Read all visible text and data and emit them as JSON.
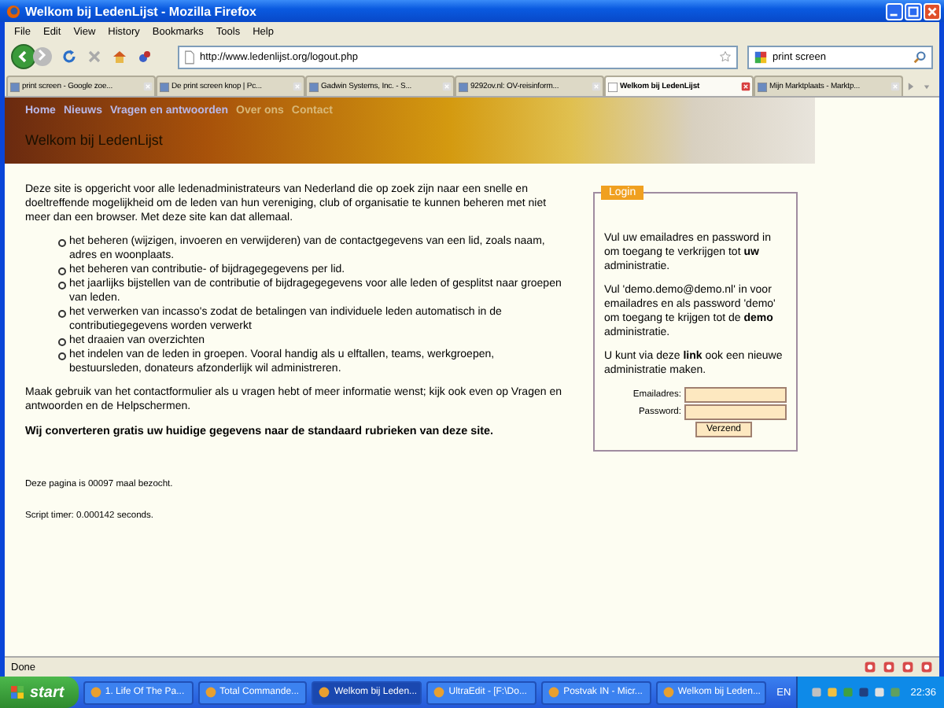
{
  "window": {
    "title": "Welkom bij LedenLijst - Mozilla Firefox"
  },
  "menu": [
    "File",
    "Edit",
    "View",
    "History",
    "Bookmarks",
    "Tools",
    "Help"
  ],
  "toolbar": {
    "url": "http://www.ledenlijst.org/logout.php",
    "search": "print screen"
  },
  "tabs": [
    {
      "label": "print screen - Google zoe...",
      "selected": false
    },
    {
      "label": "De print screen knop | Pc...",
      "selected": false
    },
    {
      "label": "Gadwin Systems, Inc. - S...",
      "selected": false
    },
    {
      "label": "9292ov.nl: OV-reisinform...",
      "selected": false
    },
    {
      "label": "Welkom bij LedenLijst",
      "selected": true
    },
    {
      "label": "Mijn Marktplaats - Marktp...",
      "selected": false
    }
  ],
  "page": {
    "nav": [
      "Home",
      "Nieuws",
      "Vragen en antwoorden",
      "Over ons",
      "Contact"
    ],
    "heading": "Welkom bij LedenLijst",
    "intro": "Deze site is opgericht voor alle ledenadministrateurs van Nederland die op zoek zijn naar een snelle en doeltreffende mogelijkheid om de leden van hun vereniging, club of organisatie te kunnen beheren met niet meer dan een browser. Met deze site kan dat allemaal.",
    "bullets": [
      "het beheren (wijzigen, invoeren en verwijderen) van de contactgegevens van een lid, zoals naam, adres en woonplaats.",
      "het beheren van contributie- of bijdragegegevens per lid.",
      "het jaarlijks bijstellen van de contributie of bijdragegegevens voor alle leden of gesplitst naar groepen van leden.",
      "het verwerken van incasso's zodat de betalingen van individuele leden automatisch in de contributiegegevens worden verwerkt",
      "het draaien van overzichten",
      "het indelen van de leden in groepen. Vooral handig als u elftallen, teams, werkgroepen, bestuursleden, donateurs afzonderlijk wil administreren."
    ],
    "contact": "Maak gebruik van het contactformulier als u vragen hebt of meer informatie wenst; kijk ook even op Vragen en antwoorden en de Helpschermen.",
    "statement": "Wij converteren gratis uw huidige gegevens naar de standaard rubrieken van deze site.",
    "counter": "Deze pagina is 00097 maal bezocht.",
    "timer": "Script timer: 0.000142 seconds.",
    "login": {
      "legend": "Login",
      "paragraphs": [
        "Vul uw emailadres en password in om toegang te verkrijgen tot **uw** administratie.",
        "Vul 'demo.demo@demo.nl' in voor emailadres en als password 'demo' om toegang te krijgen tot de **demo** administratie.",
        "U kunt via deze **link** ook een nieuwe administratie maken."
      ],
      "fields": [
        "Emailadres:",
        "Password:"
      ],
      "button": "Verzend"
    }
  },
  "status": "Done",
  "taskbar": {
    "start": "start",
    "items": [
      {
        "label": "1. Life Of The Pa...",
        "selected": false
      },
      {
        "label": "Total Commande...",
        "selected": false
      },
      {
        "label": "Welkom bij Leden...",
        "selected": true
      },
      {
        "label": "UltraEdit - [F:\\Do...",
        "selected": false
      },
      {
        "label": "Postvak IN - Micr...",
        "selected": false
      },
      {
        "label": "Welkom bij Leden...",
        "selected": false
      }
    ],
    "language": "EN",
    "clock": "22:36"
  }
}
